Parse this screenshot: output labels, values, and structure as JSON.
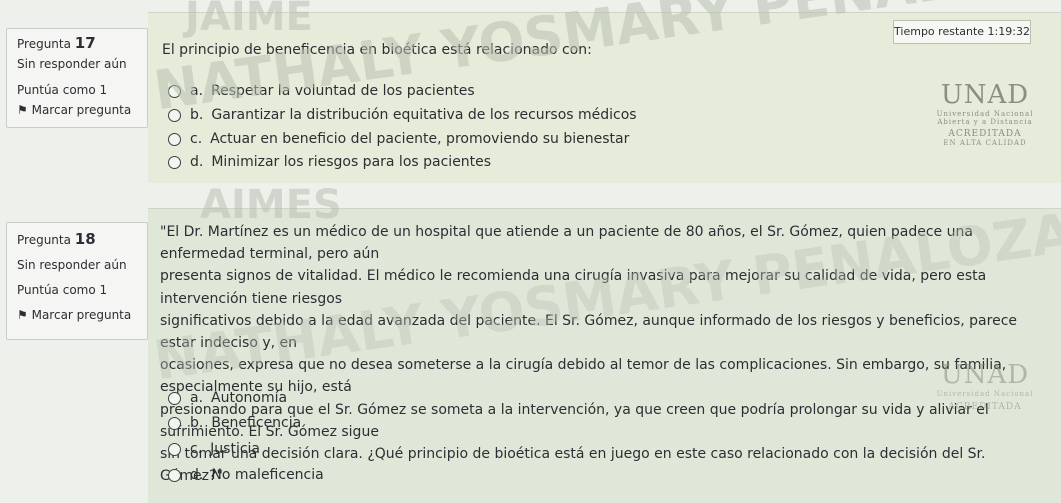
{
  "colors": {
    "accent": "#3a3f44",
    "background": "#eef0ec"
  },
  "watermarks": [
    "JAIME",
    "NATHALY YOSMARY PENALOZA",
    "AIMES"
  ],
  "timer": {
    "label": "Tiempo restante",
    "value": "1:19:32"
  },
  "q17": {
    "pregunta": "Pregunta",
    "number": "17",
    "status": "Sin responder aún",
    "score": "Puntúa como 1",
    "flag": "Marcar pregunta",
    "text": "El principio de beneficencia en bioética está relacionado con:",
    "options": [
      {
        "letter": "a.",
        "text": "Respetar la voluntad de los pacientes"
      },
      {
        "letter": "b.",
        "text": "Garantizar la distribución equitativa de los recursos médicos"
      },
      {
        "letter": "c.",
        "text": "Actuar en beneficio del paciente, promoviendo su bienestar"
      },
      {
        "letter": "d.",
        "text": "Minimizar los riesgos para los pacientes"
      }
    ]
  },
  "q18": {
    "pregunta": "Pregunta",
    "number": "18",
    "status": "Sin responder aún",
    "score": "Puntúa como 1",
    "flag": "Marcar pregunta",
    "lines": [
      "\"El Dr. Martínez es un médico de un hospital que atiende a un paciente de 80 años, el Sr. Gómez, quien padece una enfermedad terminal, pero aún",
      "presenta signos de vitalidad. El médico le recomienda una cirugía invasiva para mejorar su calidad de vida, pero esta intervención tiene riesgos",
      "significativos debido a la edad avanzada del paciente. El Sr. Gómez, aunque informado de los riesgos y beneficios, parece estar indeciso y, en",
      "ocasiones, expresa que no desea someterse a la cirugía debido al temor de las complicaciones. Sin embargo, su familia, especialmente su hijo, está",
      "presionando para que el Sr. Gómez se someta a la intervención, ya que creen que podría prolongar su vida y aliviar el sufrimiento. El Sr. Gómez sigue",
      "sin tomar una decisión clara. ¿Qué principio de bioética está en juego en este caso relacionado con la decisión del Sr. Gómez?\""
    ],
    "options": [
      {
        "letter": "a.",
        "text": "Autonomía"
      },
      {
        "letter": "b.",
        "text": "Beneficencia"
      },
      {
        "letter": "c.",
        "text": "Justicia"
      },
      {
        "letter": "d.",
        "text": "No maleficencia"
      }
    ]
  },
  "logo": {
    "name": "UNAD",
    "line1": "Universidad Nacional",
    "line2": "Abierta y a Distancia",
    "badge": "ACREDITADA",
    "badge_sub": "EN ALTA CALIDAD"
  }
}
